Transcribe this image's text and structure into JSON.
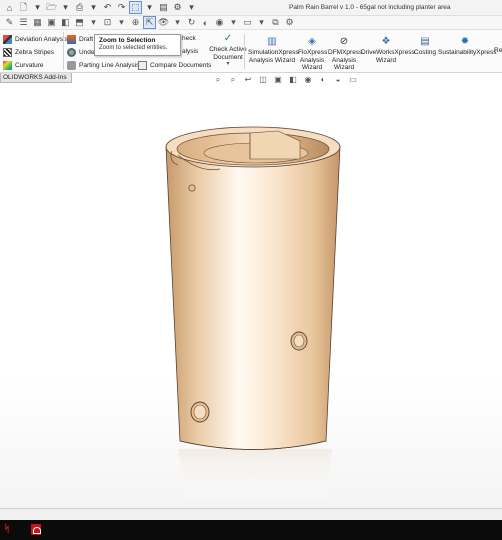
{
  "window": {
    "title": "Palm Rain  Barrel v 1.0 - 65gal not including planter area"
  },
  "ribbon": {
    "left_items": [
      {
        "label": "Deviation Analysis",
        "icon": "deviation-icon"
      },
      {
        "label": "Zebra Stripes",
        "icon": "zebra-stripes-icon"
      },
      {
        "label": "Curvature",
        "icon": "curvature-icon"
      }
    ],
    "mid_items": [
      {
        "label": "Draft",
        "icon": "draft-icon"
      },
      {
        "label": "Under",
        "icon": "undercut-icon"
      },
      {
        "label": "Parting Line Analysis",
        "icon": "parting-line-icon"
      },
      {
        "label": "Compare Documents",
        "icon": "compare-icon"
      }
    ],
    "partial_labels": [
      "heck",
      "alysis"
    ],
    "check_active": "Check Active\nDocument",
    "big_items": [
      {
        "label": "SimulationXpress\nAnalysis Wizard"
      },
      {
        "label": "FloXpress\nAnalysis\nWizard"
      },
      {
        "label": "DFMXpress\nAnalysis\nWizard"
      },
      {
        "label": "DriveWorksXpress\nWizard"
      },
      {
        "label": "Costing"
      },
      {
        "label": "SustainabilityXpress"
      },
      {
        "label": "Re"
      }
    ]
  },
  "tooltip": {
    "title": "Zoom to Selection",
    "description": "Zoom to selected entities."
  },
  "tabs": {
    "addins": "OLIDWORKS Add-Ins"
  },
  "model": {
    "color_light": "#fbe6cf",
    "color_mid": "#eacba6",
    "color_dark": "#c79a6a"
  }
}
